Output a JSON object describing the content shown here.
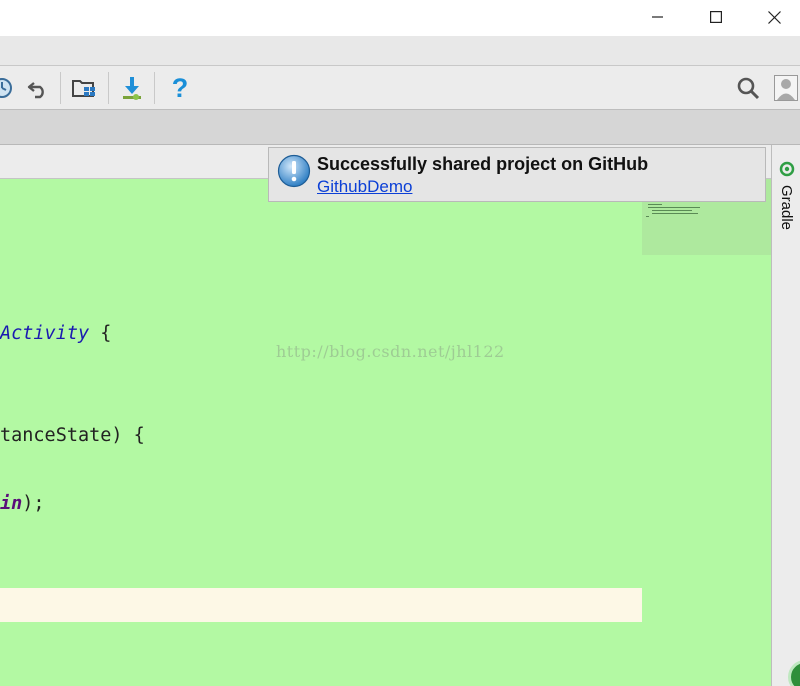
{
  "window": {
    "minimize_icon": "minimize-icon",
    "maximize_icon": "maximize-icon",
    "close_icon": "close-icon"
  },
  "toolbar": {
    "icons": [
      "history-icon",
      "undo-icon",
      "project-structure-icon",
      "sdk-manager-icon",
      "help-icon",
      "search-icon",
      "avatar-icon"
    ],
    "help_glyph": "?"
  },
  "editor": {
    "lines": [
      {
        "plain": "",
        "italic": "Activity",
        "rest": " {"
      },
      {
        "plain": "tanceState) {",
        "italic": "",
        "rest": ""
      },
      {
        "plain": "",
        "bold_italic": "in",
        "rest": ");"
      }
    ],
    "watermark": "http://blog.csdn.net/jhl122",
    "background": "#b3f9a3",
    "caret_line_color": "#fdf8e6"
  },
  "right_panel": {
    "gradle_label": "Gradle"
  },
  "notification": {
    "title": "Successfully shared project on GitHub",
    "link": "GithubDemo",
    "icon": "info-icon"
  },
  "colors": {
    "link": "#0b3fd6",
    "help_icon": "#1a8fd8"
  }
}
